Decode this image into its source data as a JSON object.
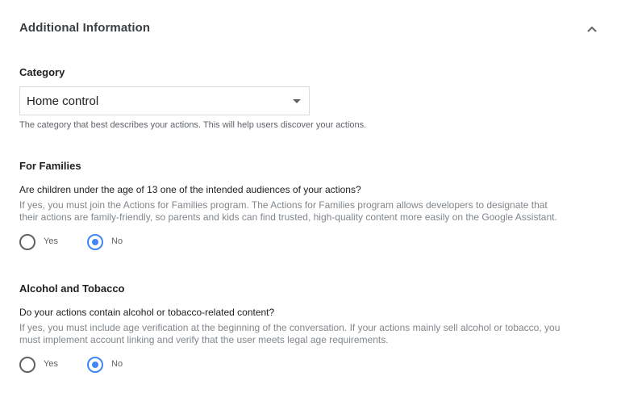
{
  "section": {
    "title": "Additional Information",
    "collapse_icon": "chevron-up-icon"
  },
  "category": {
    "label": "Category",
    "selected": "Home control",
    "hint": "The category that best describes your actions. This will help users discover your actions."
  },
  "families": {
    "title": "For Families",
    "question": "Are children under the age of 13 one of the intended audiences of your actions?",
    "desc_line1": "If yes, you must join the Actions for Families program. The Actions for Families program allows developers to designate that",
    "desc_line2": "their actions are family-friendly, so parents and kids can find trusted, high-quality content more easily on the Google Assistant.",
    "options": [
      "Yes",
      "No"
    ],
    "selected": "No"
  },
  "alcohol": {
    "title": "Alcohol and Tobacco",
    "question": "Do your actions contain alcohol or tobacco-related content?",
    "desc_line1": "If yes, you must include age verification at the beginning of the conversation. If your actions mainly sell alcohol or tobacco, you",
    "desc_line2": "must implement account linking and verify that the user meets legal age requirements.",
    "options": [
      "Yes",
      "No"
    ],
    "selected": "No"
  },
  "colors": {
    "accent": "#4285f4",
    "text": "#202124",
    "muted": "#80868b"
  }
}
